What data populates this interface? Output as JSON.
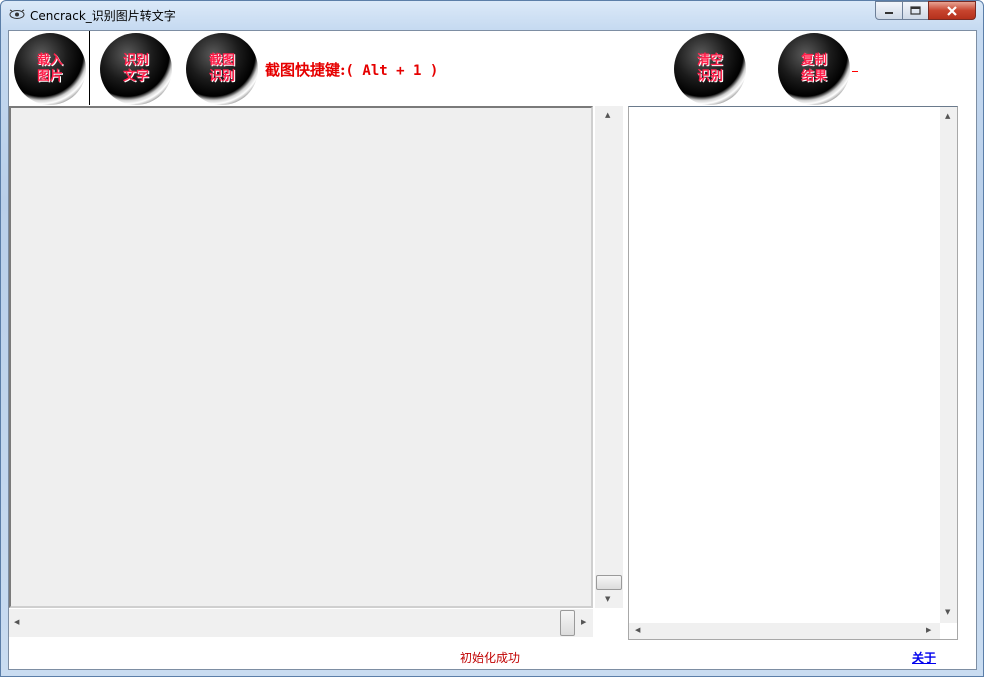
{
  "window": {
    "title": "Cencrack_识别图片转文字"
  },
  "toolbar": {
    "buttons": [
      {
        "line1": "载入",
        "line2": "图片"
      },
      {
        "line1": "识别",
        "line2": "文字"
      },
      {
        "line1": "截图",
        "line2": "识别"
      },
      {
        "line1": "清空",
        "line2": "识别"
      },
      {
        "line1": "复制",
        "line2": "结果"
      }
    ],
    "hotkey_label": "截图快捷键:",
    "hotkey_value": "( Alt + 1 )"
  },
  "status": {
    "text": "初始化成功"
  },
  "about": {
    "label": "关于"
  },
  "colors": {
    "accent_red": "#e60000",
    "status_red": "#c00000",
    "link_blue": "#0000ee"
  }
}
